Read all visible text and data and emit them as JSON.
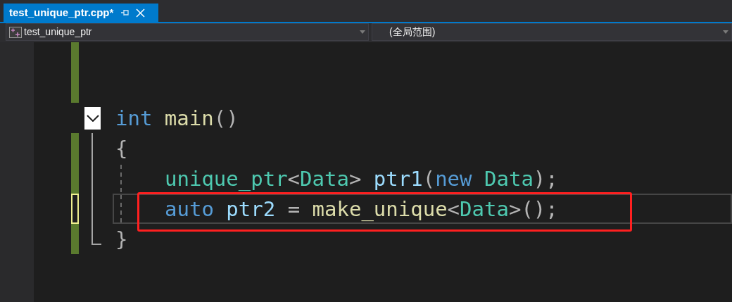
{
  "tab": {
    "title": "test_unique_ptr.cpp*",
    "selected": true
  },
  "nav": {
    "project": "test_unique_ptr",
    "scope": "(全局范围)"
  },
  "lines": [
    {
      "kind": "saved"
    },
    {
      "kind": "saved"
    },
    {
      "kind": "plain",
      "expanded": true,
      "tokens": [
        {
          "kind": "keyword",
          "text": "int "
        },
        {
          "kind": "function",
          "text": "main"
        },
        {
          "kind": "punct",
          "text": "()"
        }
      ],
      "children": [
        {
          "kind": "saved",
          "tokens": [
            {
              "kind": "punct",
              "text": "{"
            }
          ],
          "children": [
            {
              "kind": "saved",
              "current": false,
              "tokens": [
                {
                  "kind": "type",
                  "text": "unique_ptr"
                },
                {
                  "kind": "punct",
                  "text": "<"
                },
                {
                  "kind": "type",
                  "text": "Data"
                },
                {
                  "kind": "punct",
                  "text": "> "
                },
                {
                  "kind": "variable",
                  "text": "ptr1"
                },
                {
                  "kind": "punct",
                  "text": "("
                },
                {
                  "kind": "keyword",
                  "text": "new "
                },
                {
                  "kind": "type",
                  "text": "Data"
                },
                {
                  "kind": "punct",
                  "text": ");"
                }
              ]
            },
            {
              "kind": "unsaved",
              "current": true,
              "marked": true,
              "tokens": [
                {
                  "kind": "keyword",
                  "text": "auto "
                },
                {
                  "kind": "variable",
                  "text": "ptr2 "
                },
                {
                  "kind": "punct",
                  "text": "= "
                },
                {
                  "kind": "function",
                  "text": "make_unique"
                },
                {
                  "kind": "punct",
                  "text": "<"
                },
                {
                  "kind": "type",
                  "text": "Data"
                },
                {
                  "kind": "punct",
                  "text": ">();"
                }
              ]
            }
          ]
        },
        {
          "kind": "saved",
          "tokens": [
            {
              "kind": "punct",
              "text": "}"
            }
          ]
        }
      ]
    },
    {
      "kind": "plain"
    }
  ]
}
